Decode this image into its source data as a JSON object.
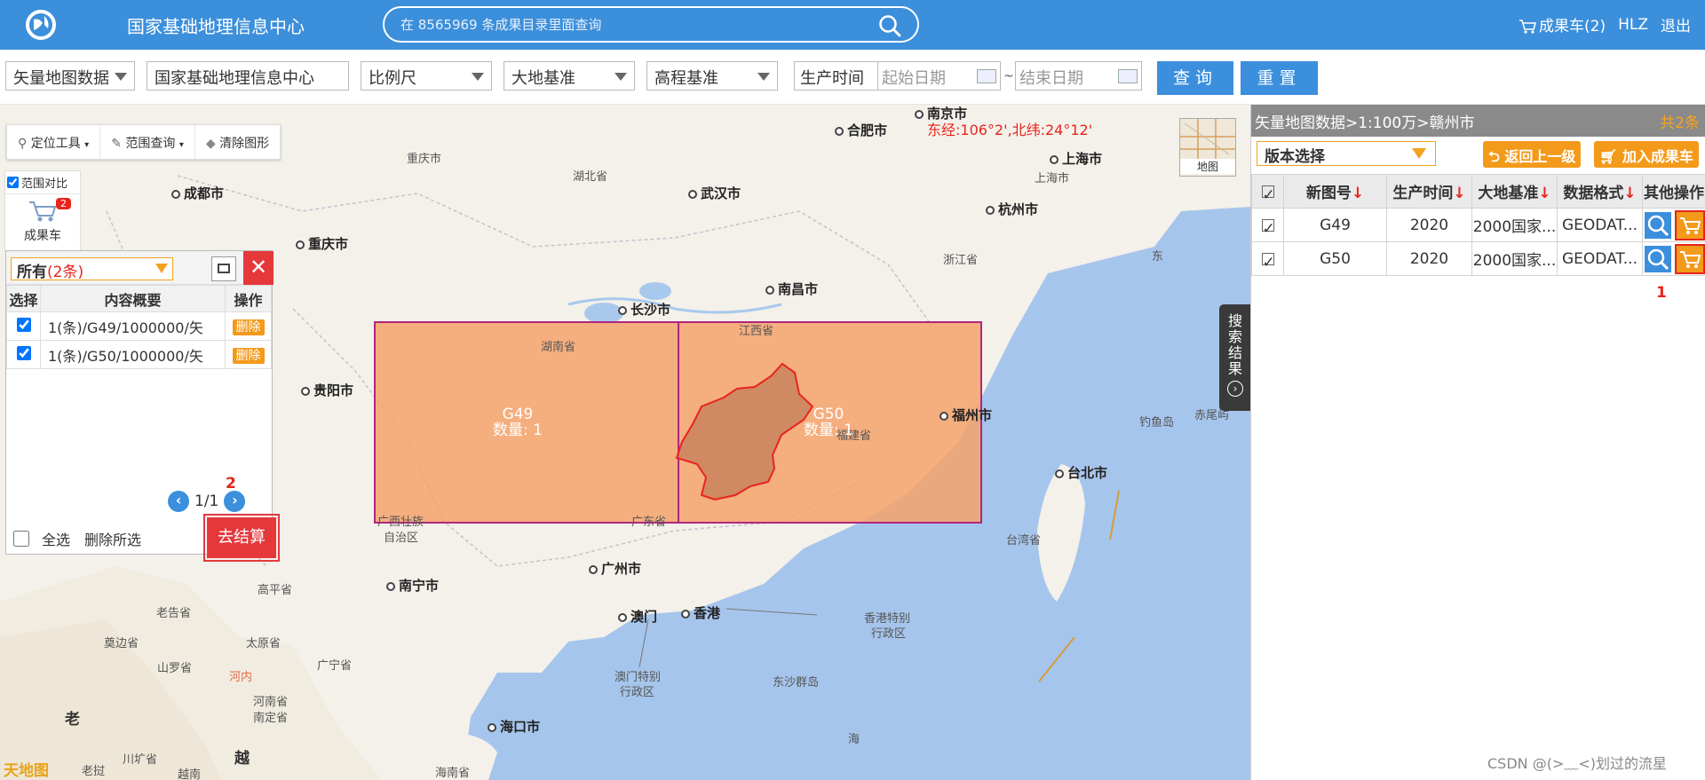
{
  "header": {
    "site_title": "国家基础地理信息中心",
    "search_placeholder": "在 8565969 条成果目录里面查询",
    "cart_label": "成果车(2)",
    "user": "HLZ",
    "logout": "退出"
  },
  "filters": {
    "data_type": "矢量地图数据",
    "organization": "国家基础地理信息中心",
    "scale": "比例尺",
    "geodetic_datum": "大地基准",
    "height_datum": "高程基准",
    "production_time_label": "生产时间",
    "start_date_placeholder": "起始日期",
    "end_date_placeholder": "结束日期",
    "query_button": "查询",
    "reset_button": "重置"
  },
  "map": {
    "tools": [
      "定位工具",
      "范围查询",
      "清除图形"
    ],
    "coordinate_readout": "东经:106°2',北纬:24°12'",
    "thumbnail_label": "地图",
    "range_compare": "范围对比",
    "cart_label": "成果车",
    "cart_badge": "2",
    "search_result_tab": "搜索结果",
    "cities": [
      "南京市",
      "合肥市",
      "上海市",
      "杭州市",
      "武汉市",
      "成都市",
      "重庆市",
      "长沙市",
      "南昌市",
      "贵阳市",
      "福州市",
      "台北市",
      "广州市",
      "南宁市",
      "香港",
      "澳门",
      "海口市"
    ],
    "provinces": [
      "湖北省",
      "浙江省",
      "湖南省",
      "江西省",
      "福建省",
      "广东省",
      "台湾省",
      "广西壮族",
      "自治区",
      "东沙群岛",
      "香港特别",
      "行政区",
      "澳门特别",
      "行政区",
      "海南省",
      "钓鱼岛",
      "赤尾屿",
      "重庆市",
      "上海市",
      "海",
      "东"
    ],
    "sheets": [
      {
        "name": "G49",
        "count_label": "数量: 1"
      },
      {
        "name": "G50",
        "count_label": "数量: 1"
      }
    ],
    "overview_labels": [
      "老挝",
      "越南",
      "老告省",
      "奠边省",
      "太原省",
      "山罗省",
      "广宁省",
      "河内",
      "河南省",
      "南定省",
      "川圹省",
      "高平省",
      "老",
      "越"
    ],
    "brand": "天地图"
  },
  "cart_panel": {
    "filter_value": "所有",
    "filter_count": "(2条)",
    "close_symbol": "✕",
    "columns": [
      "选择",
      "内容概要",
      "操作"
    ],
    "rows": [
      {
        "summary": "1(条)/G49/1000000/矢",
        "action": "删除"
      },
      {
        "summary": "1(条)/G50/1000000/矢",
        "action": "删除"
      }
    ],
    "page_indicator": "1/1",
    "select_all": "全选",
    "delete_selected": "删除所选",
    "checkout": "去结算",
    "annotation_2": "2"
  },
  "result_panel": {
    "breadcrumb": "矢量地图数据>1:100万>赣州市",
    "total": "共2条",
    "version_select": "版本选择",
    "back_button": "返回上一级",
    "add_to_cart_button": "加入成果车",
    "columns": [
      "新图号",
      "生产时间",
      "大地基准",
      "数据格式",
      "其他操作"
    ],
    "rows": [
      {
        "sheet": "G49",
        "year": "2020",
        "datum": "2000国家...",
        "format": "GEODAT..."
      },
      {
        "sheet": "G50",
        "year": "2020",
        "datum": "2000国家...",
        "format": "GEODAT..."
      }
    ],
    "annotation_1": "1"
  },
  "watermark": "CSDN @(>﹏<)划过的流星",
  "colors": {
    "header_blue": "#3c8fdb",
    "button_blue": "#3b8fdc",
    "orange": "#f39a1b",
    "red": "#e5383b",
    "sheet_fill": "#f5a26b",
    "sheet_border": "#b0267f"
  }
}
